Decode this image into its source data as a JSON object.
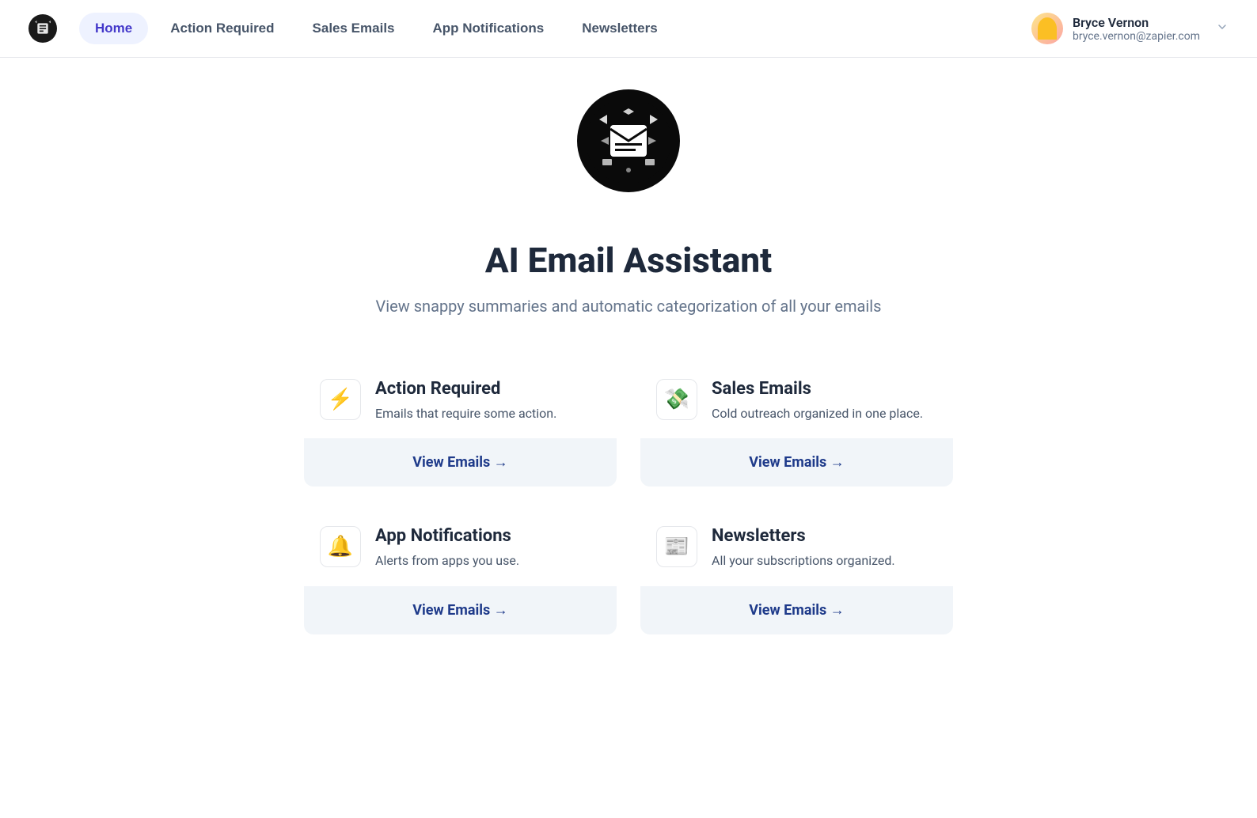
{
  "nav": {
    "tabs": [
      {
        "label": "Home",
        "active": true
      },
      {
        "label": "Action Required",
        "active": false
      },
      {
        "label": "Sales Emails",
        "active": false
      },
      {
        "label": "App Notifications",
        "active": false
      },
      {
        "label": "Newsletters",
        "active": false
      }
    ]
  },
  "user": {
    "name": "Bryce Vernon",
    "email": "bryce.vernon@zapier.com"
  },
  "hero": {
    "title": "AI Email Assistant",
    "subtitle": "View snappy summaries and automatic categorization of all your emails"
  },
  "cards": [
    {
      "icon": "⚡",
      "title": "Action Required",
      "description": "Emails that require some action.",
      "button": "View Emails →"
    },
    {
      "icon": "💸",
      "title": "Sales Emails",
      "description": "Cold outreach organized in one place.",
      "button": "View Emails →"
    },
    {
      "icon": "🔔",
      "title": "App Notifications",
      "description": "Alerts from apps you use.",
      "button": "View Emails →"
    },
    {
      "icon": "📰",
      "title": "Newsletters",
      "description": "All your subscriptions organized.",
      "button": "View Emails →"
    }
  ]
}
